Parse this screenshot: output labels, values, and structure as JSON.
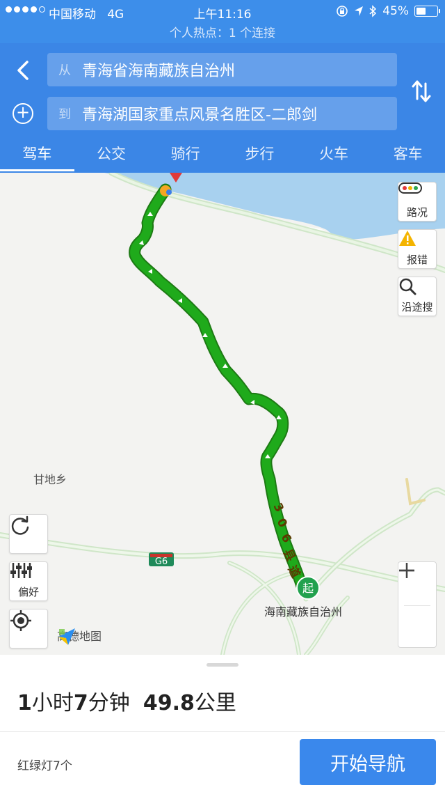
{
  "status_bar": {
    "carrier": "中国移动",
    "network": "4G",
    "time": "上午11:16",
    "battery": "45%",
    "battery_level": 0.45,
    "hotspot": "个人热点：1 个连接"
  },
  "route": {
    "from_prefix": "从",
    "from": "青海省海南藏族自治州",
    "to_prefix": "到",
    "to": "青海湖国家重点风景名胜区-二郎剑"
  },
  "tabs": [
    "驾车",
    "公交",
    "骑行",
    "步行",
    "火车",
    "客车"
  ],
  "active_tab": 0,
  "map": {
    "controls": {
      "traffic": "路况",
      "report": "报错",
      "search_along": "沿途搜",
      "preference": "偏好"
    },
    "labels": {
      "town": "甘地乡",
      "road_badge": "G6",
      "road_name": "306县道",
      "start_marker": "起",
      "start_place": "海南藏族自治州"
    },
    "logo_text": "高德地图",
    "route_color": "#1faa1b",
    "water_color": "#a8d1ef"
  },
  "summary": {
    "hours": "1",
    "hour_unit": "小时",
    "minutes": "7",
    "minute_unit": "分钟",
    "distance": "49.8",
    "distance_unit": "公里"
  },
  "traffic_lights": "红绿灯7个",
  "start_nav_button": "开始导航"
}
